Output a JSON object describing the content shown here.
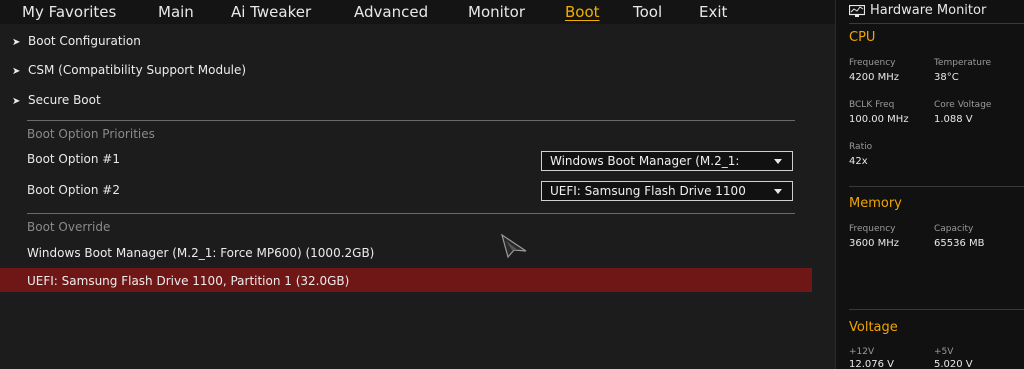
{
  "menu": {
    "tabs": [
      {
        "label": "My Favorites"
      },
      {
        "label": "Main"
      },
      {
        "label": "Ai Tweaker"
      },
      {
        "label": "Advanced"
      },
      {
        "label": "Monitor"
      },
      {
        "label": "Boot"
      },
      {
        "label": "Tool"
      },
      {
        "label": "Exit"
      }
    ],
    "active_tab": "Boot"
  },
  "submenus": [
    {
      "label": "Boot Configuration"
    },
    {
      "label": "CSM (Compatibility Support Module)"
    },
    {
      "label": "Secure Boot"
    }
  ],
  "boot_priorities": {
    "heading": "Boot Option Priorities",
    "options": [
      {
        "label": "Boot Option #1",
        "value": "Windows Boot Manager (M.2_1:"
      },
      {
        "label": "Boot Option #2",
        "value": "UEFI: Samsung Flash Drive 1100"
      }
    ]
  },
  "boot_override": {
    "heading": "Boot Override",
    "items": [
      {
        "label": "Windows Boot Manager (M.2_1: Force MP600) (1000.2GB)"
      },
      {
        "label": "UEFI: Samsung Flash Drive 1100, Partition 1 (32.0GB)"
      }
    ],
    "selected_index": 1
  },
  "hardware_monitor": {
    "title": "Hardware Monitor",
    "cpu": {
      "heading": "CPU",
      "frequency_label": "Frequency",
      "frequency": "4200 MHz",
      "temperature_label": "Temperature",
      "temperature": "38°C",
      "bclk_label": "BCLK Freq",
      "bclk": "100.00 MHz",
      "core_voltage_label": "Core Voltage",
      "core_voltage": "1.088 V",
      "ratio_label": "Ratio",
      "ratio": "42x"
    },
    "memory": {
      "heading": "Memory",
      "frequency_label": "Frequency",
      "frequency": "3600 MHz",
      "capacity_label": "Capacity",
      "capacity": "65536 MB"
    },
    "voltage": {
      "heading": "Voltage",
      "v12_label": "+12V",
      "v12": "12.076 V",
      "v5_label": "+5V",
      "v5": "5.020 V"
    }
  },
  "colors": {
    "accent": "#f0b000",
    "selection": "#6f1616",
    "panel": "#111111"
  }
}
